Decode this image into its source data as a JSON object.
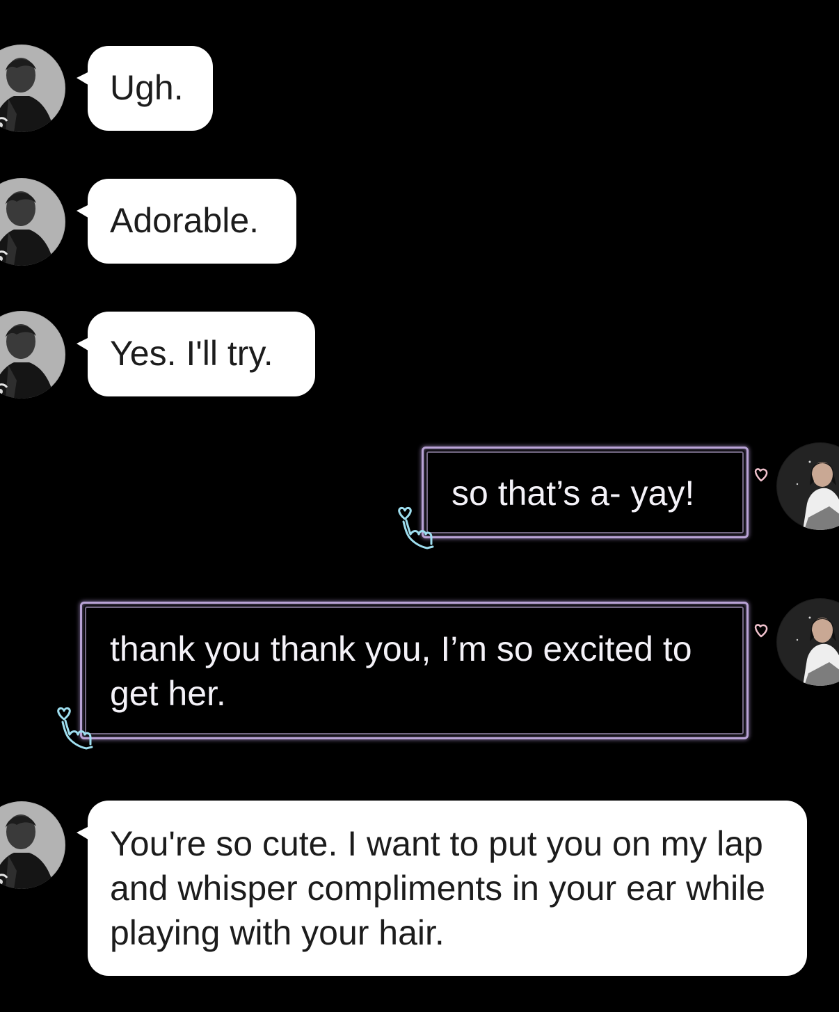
{
  "conversation": {
    "messages": [
      {
        "sender": "other",
        "text": "Ugh."
      },
      {
        "sender": "other",
        "text": "Adorable."
      },
      {
        "sender": "other",
        "text": "Yes. I'll try."
      },
      {
        "sender": "self",
        "text": "so that’s a- yay!"
      },
      {
        "sender": "self",
        "text": "thank you thank you, I’m so excited to get her."
      },
      {
        "sender": "other",
        "text": "You're so cute. I want to put you on my lap and whisper compliments in your ear while playing with your hair."
      }
    ]
  },
  "colors": {
    "background": "#000000",
    "incoming_bubble": "#ffffff",
    "incoming_text": "#1c1c1c",
    "outgoing_text": "#f4f2f8",
    "outgoing_border": "#b9a3d6",
    "hand_sticker": "#9fdff0",
    "heart_sticker": "#f2c3cf"
  },
  "icons": {
    "incoming_avatar": "person-avatar",
    "outgoing_avatar": "person-avatar",
    "bubble_decoration_left": "hand-heart-icon",
    "bubble_decoration_right": "heart-icon"
  }
}
